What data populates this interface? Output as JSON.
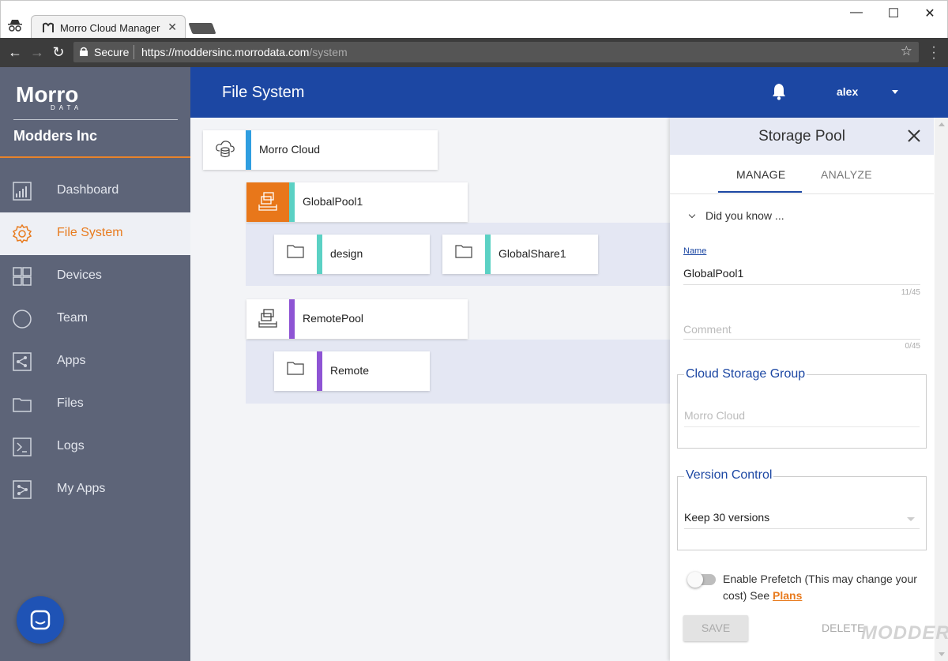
{
  "browser": {
    "tab_title": "Morro Cloud Manager",
    "secure_label": "Secure",
    "url_host": "https://moddersinc.morrodata.com",
    "url_path": "/system"
  },
  "sidebar": {
    "logo_text": "Morro",
    "logo_sub": "DATA",
    "org_name": "Modders Inc",
    "items": [
      {
        "label": "Dashboard",
        "icon": "chart-icon"
      },
      {
        "label": "File System",
        "icon": "gear-icon",
        "active": true
      },
      {
        "label": "Devices",
        "icon": "grid-icon"
      },
      {
        "label": "Team",
        "icon": "circle-icon"
      },
      {
        "label": "Apps",
        "icon": "share-icon"
      },
      {
        "label": "Files",
        "icon": "folder-icon"
      },
      {
        "label": "Logs",
        "icon": "terminal-icon"
      },
      {
        "label": "My Apps",
        "icon": "myapps-icon"
      }
    ]
  },
  "header": {
    "title": "File System",
    "user": "alex"
  },
  "tree": {
    "root": "Morro Cloud",
    "pools": [
      {
        "label": "GlobalPool1",
        "shares": [
          "design",
          "GlobalShare1"
        ]
      },
      {
        "label": "RemotePool",
        "shares": [
          "Remote"
        ]
      }
    ]
  },
  "panel": {
    "title": "Storage Pool",
    "tabs": [
      "MANAGE",
      "ANALYZE"
    ],
    "did_you_know": "Did you know ...",
    "name_label": "Name",
    "name_value": "GlobalPool1",
    "name_count": "11/45",
    "comment_placeholder": "Comment",
    "comment_count": "0/45",
    "cloud_group_legend": "Cloud Storage Group",
    "cloud_group_value": "Morro Cloud",
    "version_legend": "Version Control",
    "version_value": "Keep 30 versions",
    "prefetch_text": "Enable Prefetch (This may change your cost) See ",
    "plans_link": "Plans",
    "save_label": "SAVE",
    "delete_label": "DELETE"
  },
  "watermark": "MODDERS",
  "colors": {
    "accent_blue": "#1c47a3",
    "accent_orange": "#e87b1e",
    "sidebar_bg": "#5d6478",
    "bar_cloud": "#2f9ee0",
    "bar_pool": "#5bd1c4",
    "bar_remote": "#8e54d4"
  }
}
